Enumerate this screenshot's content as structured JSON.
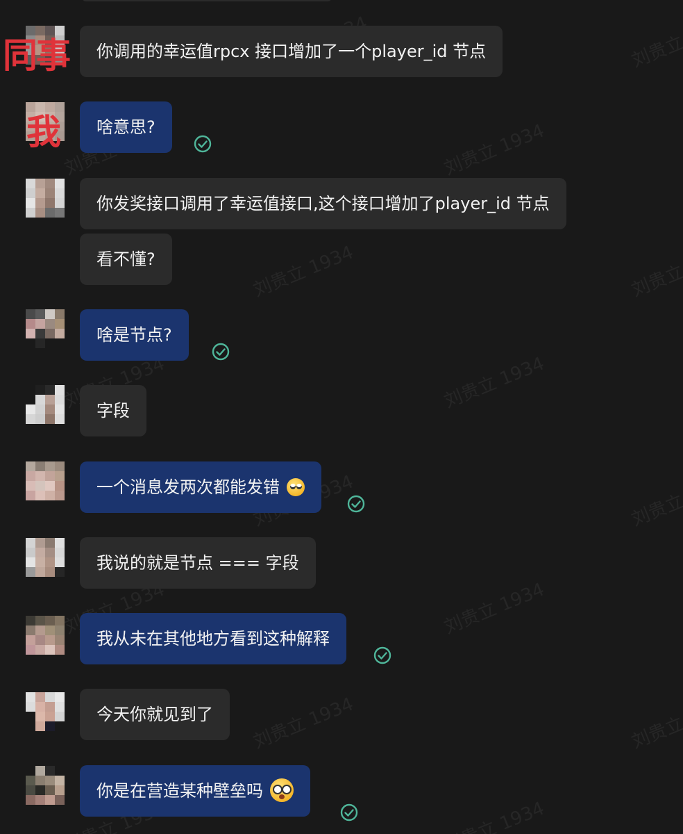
{
  "annotations": {
    "colleague": "同事",
    "me": "我"
  },
  "watermark": "刘贵立 1934",
  "messages": [
    {
      "id": 1,
      "sender": "colleague",
      "text": "你调用的幸运值rpcx 接口增加了一个player_id 节点"
    },
    {
      "id": 2,
      "sender": "me",
      "text": "啥意思?",
      "read": true
    },
    {
      "id": 3,
      "sender": "colleague",
      "text": "你发奖接口调用了幸运值接口,这个接口增加了player_id 节点"
    },
    {
      "id": 4,
      "sender": "colleague",
      "text": "看不懂?"
    },
    {
      "id": 5,
      "sender": "me",
      "text": "啥是节点?",
      "read": true
    },
    {
      "id": 6,
      "sender": "colleague",
      "text": "字段"
    },
    {
      "id": 7,
      "sender": "me",
      "text": "一个消息发两次都能发错",
      "emoji": "face-with-rolling-eyes",
      "read": true
    },
    {
      "id": 8,
      "sender": "colleague",
      "text": "我说的就是节点 === 字段"
    },
    {
      "id": 9,
      "sender": "me",
      "text": "我从未在其他地方看到这种解释",
      "read": true
    },
    {
      "id": 10,
      "sender": "colleague",
      "text": "今天你就见到了"
    },
    {
      "id": 11,
      "sender": "me",
      "text": "你是在营造某种壁垒吗",
      "emoji": "flushed-face",
      "read": true
    }
  ],
  "colors": {
    "background": "#191919",
    "incoming_bubble": "#2b2b2b",
    "outgoing_bubble": "#1b346e",
    "read_check": "#4fb69a",
    "annotation_red": "#e0333a"
  }
}
